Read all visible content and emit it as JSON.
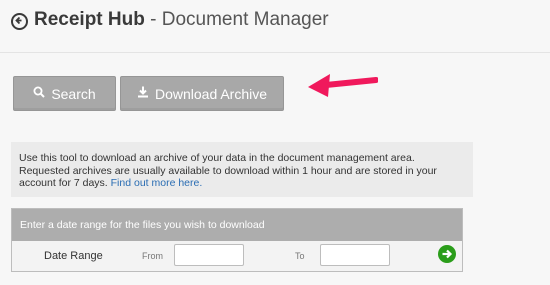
{
  "header": {
    "app_name": "Receipt Hub",
    "separator": "-",
    "section": "Document Manager",
    "back_icon": "circle-arrow-left-icon"
  },
  "toolbar": {
    "search_label": "Search",
    "search_icon": "search-icon",
    "download_label": "Download Archive",
    "download_icon": "download-icon"
  },
  "annotation": {
    "arrow_color": "#f0195c"
  },
  "info": {
    "text": "Use this tool to download an archive of your data in the document management area. Requested archives are usually available to download within 1 hour and are stored in your account for 7 days.",
    "link_text": "Find out more here."
  },
  "date_panel": {
    "heading": "Enter a date range for the files you wish to download",
    "row_label": "Date Range",
    "from_label": "From",
    "to_label": "To",
    "from_value": "",
    "to_value": "",
    "go_icon": "arrow-right-circle-icon"
  },
  "colors": {
    "button_bg": "#a8a8a8",
    "panel_head_bg": "#adadad",
    "link": "#2a6db3",
    "go_button": "#2a9d1a"
  }
}
